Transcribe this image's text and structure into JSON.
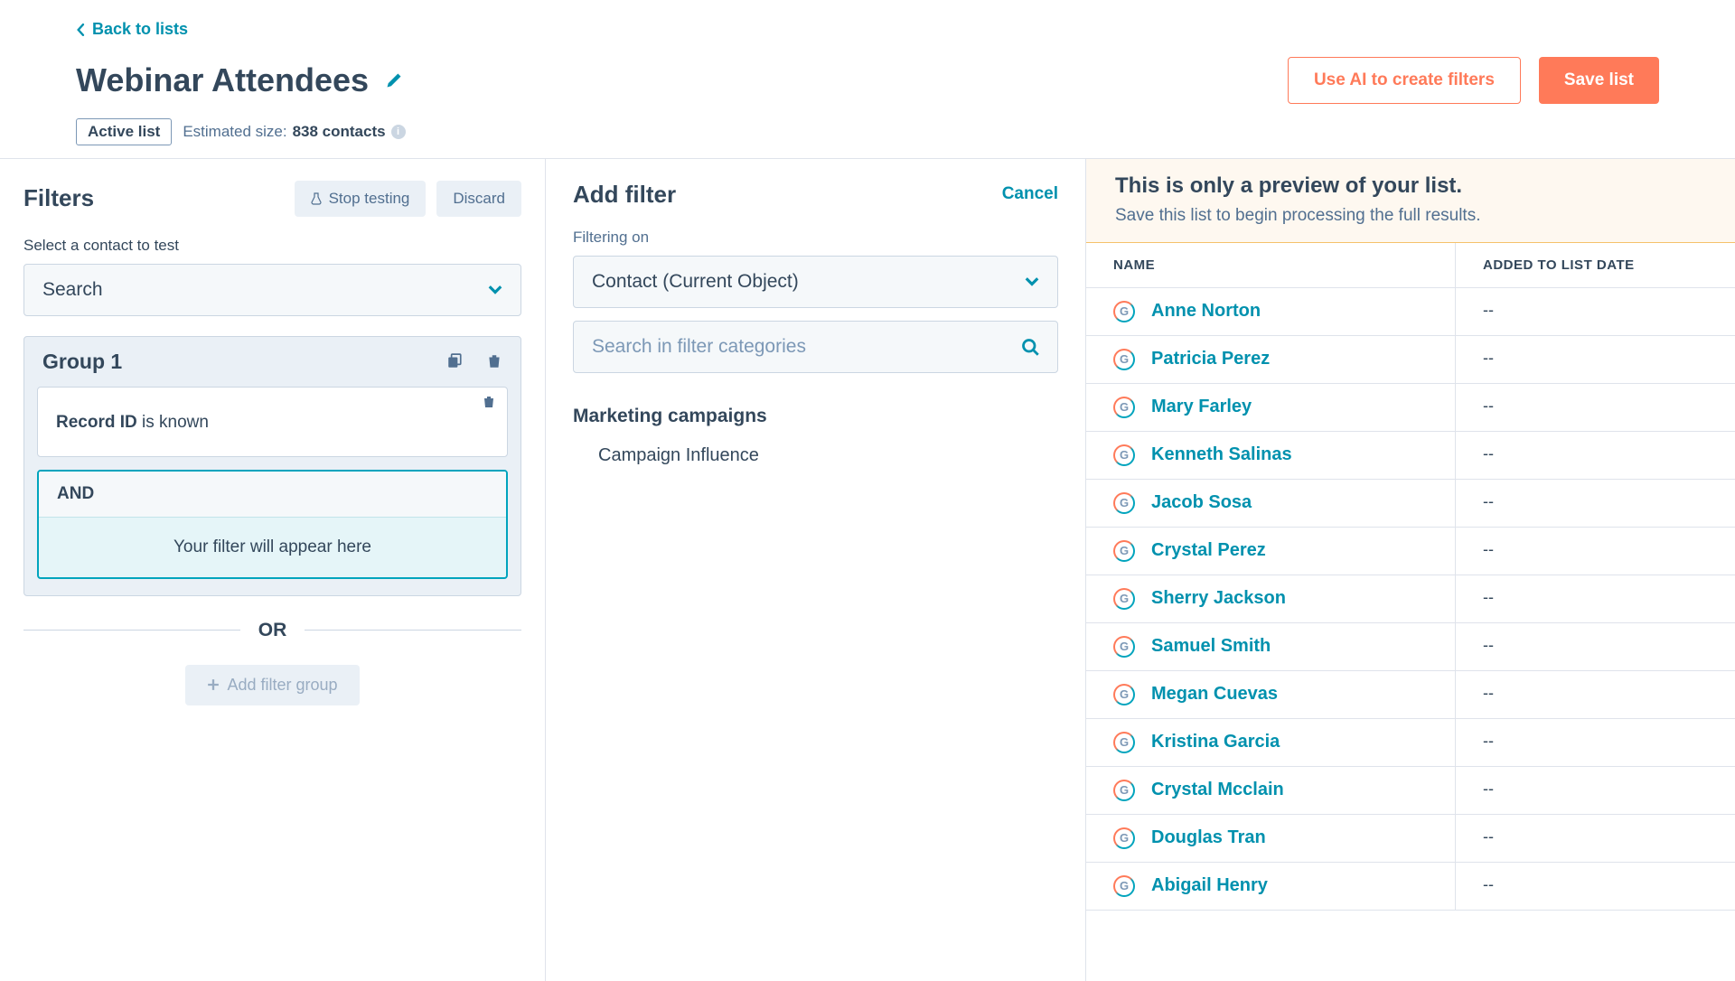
{
  "nav": {
    "back_label": "Back to lists"
  },
  "header": {
    "title": "Webinar Attendees",
    "badge": "Active list",
    "estimate_prefix": "Estimated size: ",
    "estimate_value": "838 contacts",
    "ai_button": "Use AI to create filters",
    "save_button": "Save list"
  },
  "filters": {
    "heading": "Filters",
    "stop_testing": "Stop testing",
    "discard": "Discard",
    "select_label": "Select a contact to test",
    "search_placeholder": "Search",
    "group_title": "Group 1",
    "filter_field": "Record ID",
    "filter_op": " is known",
    "and_label": "AND",
    "placeholder_text": "Your filter will appear here",
    "or_label": "OR",
    "add_group": "Add filter group"
  },
  "add_filter": {
    "heading": "Add filter",
    "cancel": "Cancel",
    "filtering_on_label": "Filtering on",
    "object_select": "Contact (Current Object)",
    "search_placeholder": "Search in filter categories",
    "category_heading": "Marketing campaigns",
    "category_item": "Campaign Influence"
  },
  "preview": {
    "banner_title": "This is only a preview of your list.",
    "banner_text": "Save this list to begin processing the full results.",
    "col_name": "NAME",
    "col_date": "ADDED TO LIST DATE",
    "rows": [
      {
        "name": "Anne Norton",
        "date": "--"
      },
      {
        "name": "Patricia Perez",
        "date": "--"
      },
      {
        "name": "Mary Farley",
        "date": "--"
      },
      {
        "name": "Kenneth Salinas",
        "date": "--"
      },
      {
        "name": "Jacob Sosa",
        "date": "--"
      },
      {
        "name": "Crystal Perez",
        "date": "--"
      },
      {
        "name": "Sherry Jackson",
        "date": "--"
      },
      {
        "name": "Samuel Smith",
        "date": "--"
      },
      {
        "name": "Megan Cuevas",
        "date": "--"
      },
      {
        "name": "Kristina Garcia",
        "date": "--"
      },
      {
        "name": "Crystal Mcclain",
        "date": "--"
      },
      {
        "name": "Douglas Tran",
        "date": "--"
      },
      {
        "name": "Abigail Henry",
        "date": "--"
      }
    ]
  }
}
